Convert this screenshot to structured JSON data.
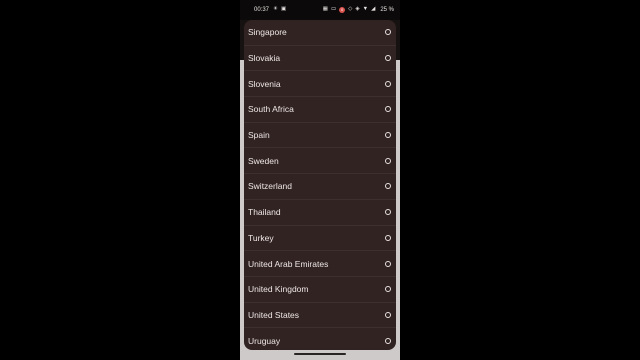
{
  "status_bar": {
    "time": "00:37",
    "left_icons": [
      "☀",
      "▣"
    ],
    "right_icons": [
      "▦",
      "▭"
    ],
    "notification_count": "0",
    "signal_icons": [
      "◇",
      "◈",
      "▼",
      "◢"
    ],
    "battery": "25 %"
  },
  "country_list": {
    "items": [
      {
        "label": "Singapore"
      },
      {
        "label": "Slovakia"
      },
      {
        "label": "Slovenia"
      },
      {
        "label": "South Africa"
      },
      {
        "label": "Spain"
      },
      {
        "label": "Sweden"
      },
      {
        "label": "Switzerland"
      },
      {
        "label": "Thailand"
      },
      {
        "label": "Turkey"
      },
      {
        "label": "United Arab Emirates"
      },
      {
        "label": "United Kingdom"
      },
      {
        "label": "United States"
      },
      {
        "label": "Uruguay"
      }
    ]
  }
}
